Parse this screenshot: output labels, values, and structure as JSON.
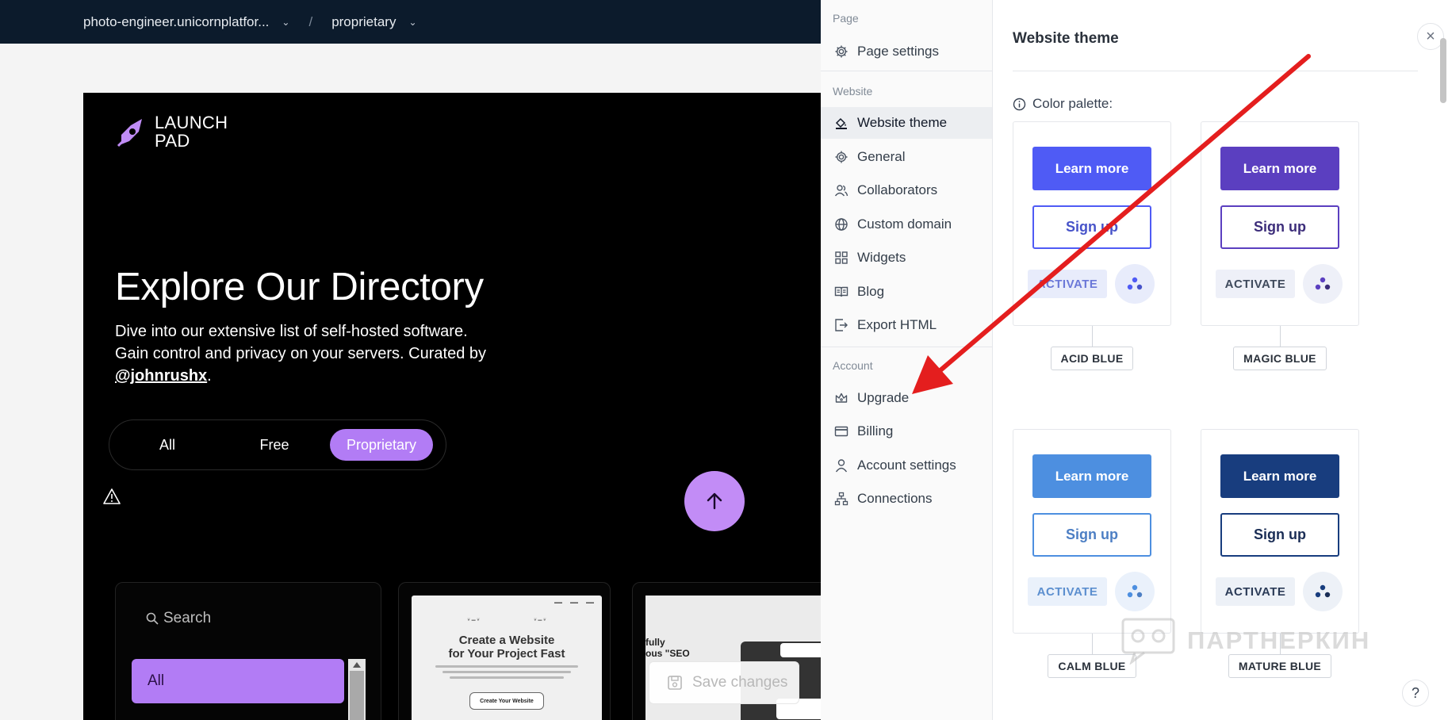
{
  "topbar": {
    "project": "photo-engineer.unicornplatfor...",
    "separator": "/",
    "page": "proprietary"
  },
  "site": {
    "logo_text": "LAUNCH PAD",
    "hero_title": "Explore Our Directory",
    "hero_desc_line1": "Dive into our extensive list of self-hosted software.",
    "hero_desc_line2": "Gain control and privacy on your servers. Curated by",
    "hero_handle": "@johnrushx",
    "hero_period": ".",
    "filters": [
      "All",
      "Free",
      "Proprietary"
    ],
    "active_filter": "Proprietary",
    "search_placeholder": "Search",
    "category_selected": "All",
    "card2_title_line1": "Create a Website",
    "card2_title_line2": "for Your Project Fast",
    "card2_button": "Create Your Website",
    "card3_text_line1": "fully",
    "card3_text_line2": "ous \"SEO",
    "save_changes": "Save changes"
  },
  "menu": {
    "sections": {
      "page": "Page",
      "website": "Website",
      "account": "Account"
    },
    "page_items": [
      {
        "label": "Page settings",
        "icon": "gear-icon"
      }
    ],
    "website_items": [
      {
        "label": "Website theme",
        "icon": "paint-bucket-icon",
        "active": true
      },
      {
        "label": "General",
        "icon": "gear-icon"
      },
      {
        "label": "Collaborators",
        "icon": "users-icon"
      },
      {
        "label": "Custom domain",
        "icon": "globe-icon"
      },
      {
        "label": "Widgets",
        "icon": "grid-icon"
      },
      {
        "label": "Blog",
        "icon": "book-icon"
      },
      {
        "label": "Export HTML",
        "icon": "export-icon"
      }
    ],
    "account_items": [
      {
        "label": "Upgrade",
        "icon": "crown-icon"
      },
      {
        "label": "Billing",
        "icon": "card-icon"
      },
      {
        "label": "Account settings",
        "icon": "user-icon"
      },
      {
        "label": "Connections",
        "icon": "sitemap-icon"
      }
    ]
  },
  "panel": {
    "title": "Website theme",
    "palette_label": "Color palette:",
    "learn_label": "Learn more",
    "signup_label": "Sign up",
    "activate_label": "ACTIVATE",
    "themes": [
      {
        "name": "ACID BLUE",
        "primary": "#4f5bf5",
        "text": "#4753c9",
        "activate_bg": "#e8ecfb",
        "activate_text": "#6b78d8"
      },
      {
        "name": "MAGIC BLUE",
        "primary": "#5b3fc0",
        "text": "#3c2d7a",
        "activate_bg": "#eef0f8",
        "activate_text": "#3f4a5c"
      },
      {
        "name": "CALM BLUE",
        "primary": "#4d8fe0",
        "text": "#4d7fc4",
        "activate_bg": "#eaf1fb",
        "activate_text": "#5c8fcf"
      },
      {
        "name": "MATURE BLUE",
        "primary": "#183d7e",
        "text": "#1a2d55",
        "activate_bg": "#edf1f7",
        "activate_text": "#2b3b57"
      }
    ]
  },
  "watermark": "ПАРТНЕРКИН",
  "help": "?",
  "close": "×"
}
